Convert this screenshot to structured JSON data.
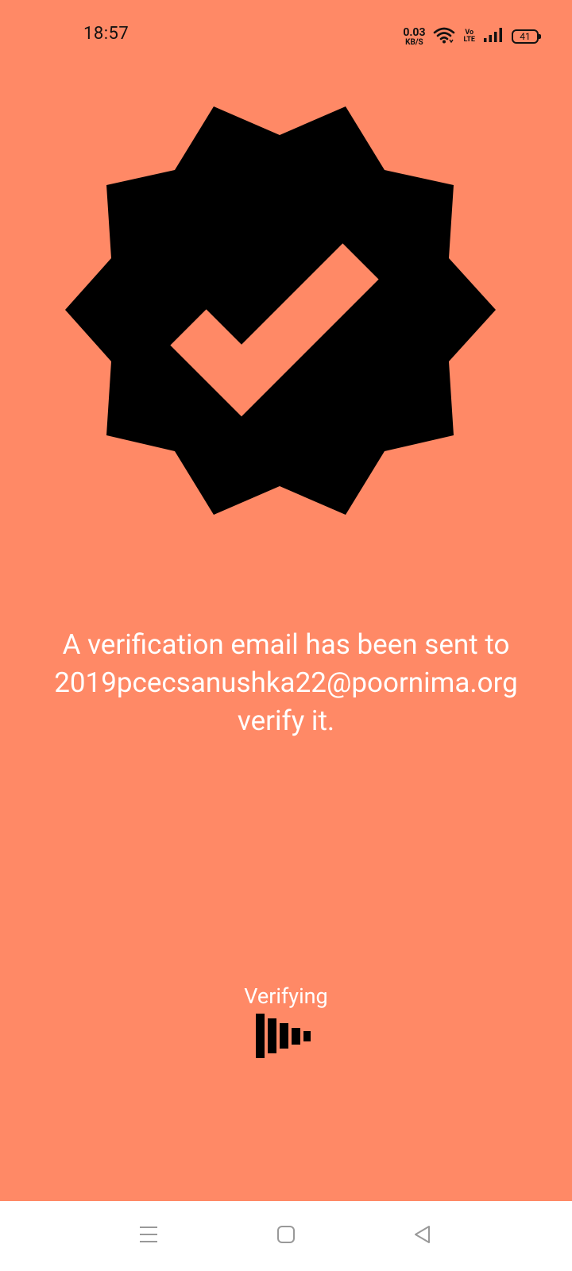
{
  "status_bar": {
    "time": "18:57",
    "net_speed_value": "0.03",
    "net_speed_unit": "KB/S",
    "volte_top": "Vo",
    "volte_bottom": "LTE",
    "battery_level": "41",
    "icons": [
      "wifi-icon",
      "volte-icon",
      "signal-icon",
      "battery-icon"
    ]
  },
  "badge": {
    "icon": "verified-badge-icon",
    "badge_color": "#000000",
    "check_color": "#ff8966"
  },
  "message": {
    "line1": "A verification email has been sent to",
    "line2": "2019pcecsanushka22@poornima.org",
    "line3": "verify it."
  },
  "status": {
    "label": "Verifying",
    "loader_icon": "loading-bars-icon"
  },
  "nav_bar": {
    "recents_icon": "menu-lines-icon",
    "home_icon": "home-square-icon",
    "back_icon": "back-triangle-icon"
  },
  "theme": {
    "background": "#ff8966",
    "text": "#ffffff",
    "nav_background": "#ffffff"
  }
}
